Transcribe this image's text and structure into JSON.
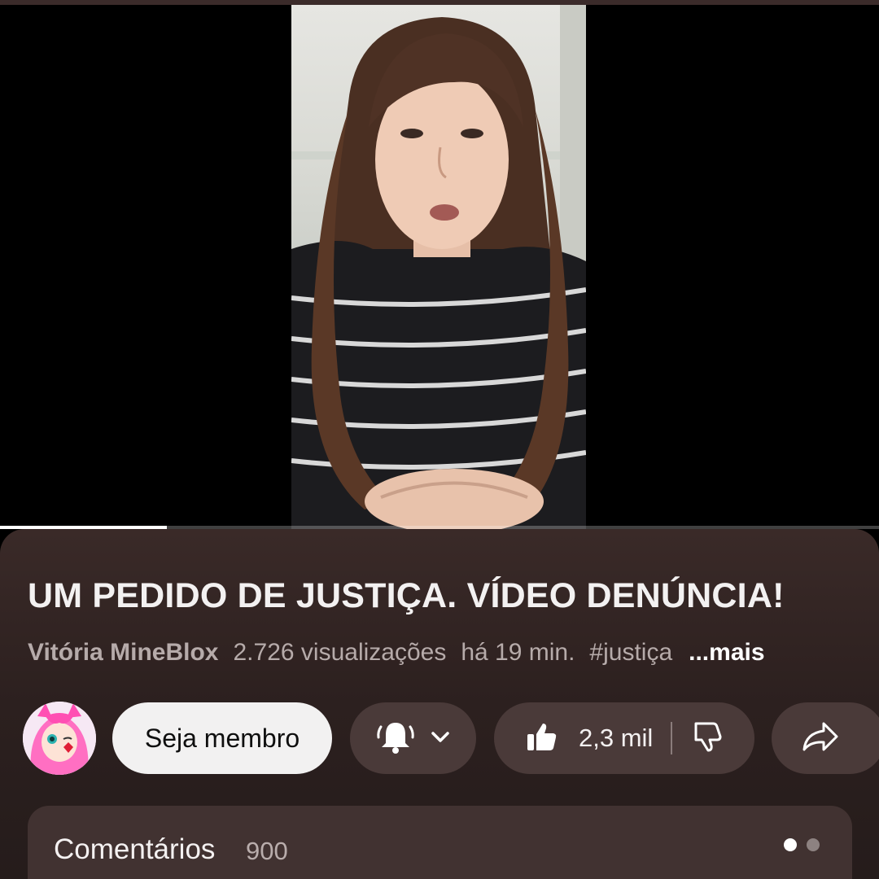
{
  "player": {
    "progress_fraction": 0.19
  },
  "video": {
    "title": "UM PEDIDO DE JUSTIÇA. VÍDEO DENÚNCIA!",
    "channel": "Vitória MineBlox",
    "views": "2.726 visualizações",
    "age": "há 19 min.",
    "hashtag": "#justiça",
    "more_label": "...mais"
  },
  "actions": {
    "join_label": "Seja membro",
    "like_count": "2,3 mil",
    "icons": [
      "bell-icon",
      "chevron-down-icon",
      "thumbs-up-icon",
      "thumbs-down-icon",
      "share-icon"
    ]
  },
  "comments": {
    "label": "Comentários",
    "count": "900"
  },
  "colors": {
    "sheet_bg": "#2c201f",
    "pill_bg": "#4a3a39",
    "join_bg": "#f2f1f1"
  }
}
